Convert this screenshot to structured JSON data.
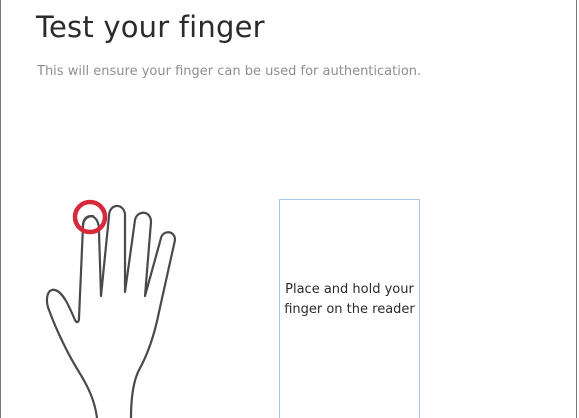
{
  "page": {
    "title": "Test your finger",
    "subtitle": "This will ensure your finger can be used for authentication."
  },
  "illustration": {
    "icon": "hand-icon",
    "highlight_icon": "fingertip-target-icon",
    "highlight_color": "#d8283c"
  },
  "reader": {
    "instruction": "Place and hold your finger on the reader",
    "border_color": "#a9c6ea"
  }
}
